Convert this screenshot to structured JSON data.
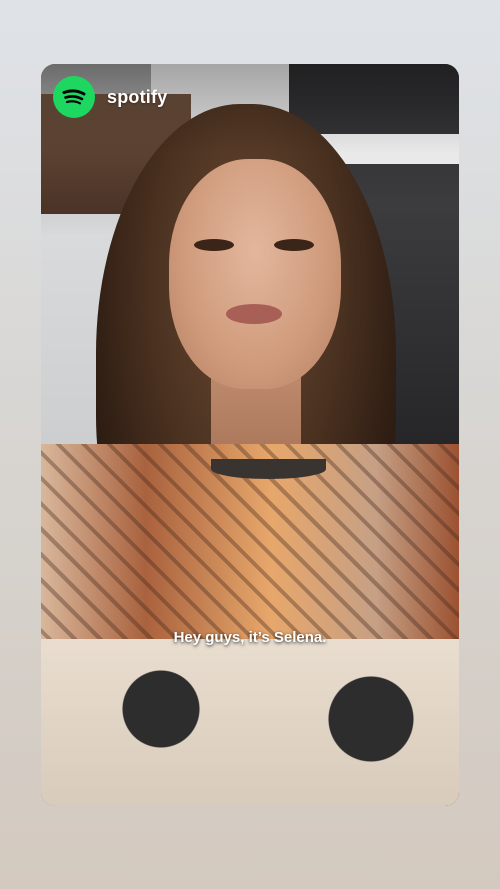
{
  "brand": {
    "name": "spotify",
    "logo_icon": "spotify-logo-icon",
    "logo_color": "#1ED760"
  },
  "video": {
    "caption": "Hey guys, it’s Selena."
  }
}
